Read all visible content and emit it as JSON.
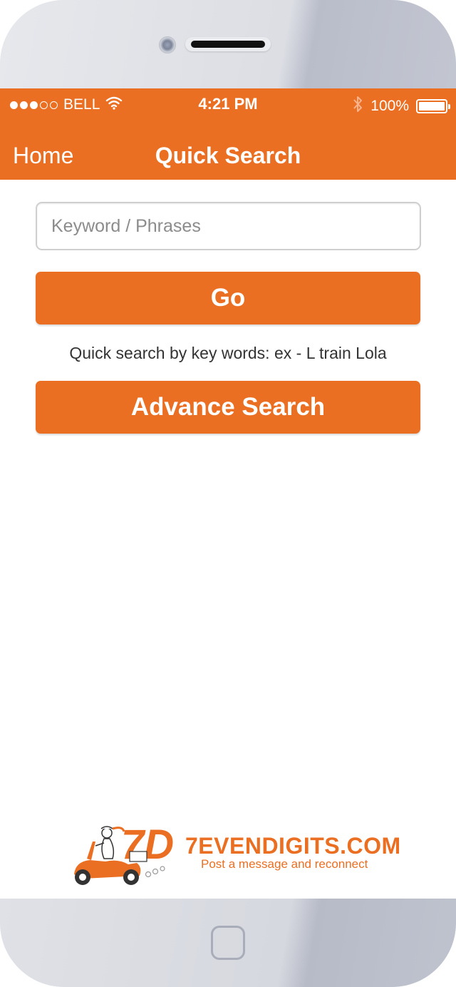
{
  "status_bar": {
    "carrier": "BELL",
    "signal_bars_filled": 3,
    "signal_bars_total": 5,
    "time": "4:21 PM",
    "battery": "100%"
  },
  "nav": {
    "back_label": "Home",
    "title": "Quick Search"
  },
  "search": {
    "value": "",
    "placeholder": "Keyword / Phrases"
  },
  "buttons": {
    "go": "Go",
    "advance": "Advance Search"
  },
  "hint": "Quick search by key words: ex - L train Lola",
  "logo": {
    "mark": "7D",
    "brand": "7EVENDIGITS.COM",
    "tagline": "Post a message and reconnect"
  },
  "colors": {
    "accent": "#ea6f22",
    "frame": "#d9dbe2"
  },
  "icons": [
    "wifi-icon",
    "bluetooth-icon",
    "battery-icon",
    "home-button"
  ]
}
